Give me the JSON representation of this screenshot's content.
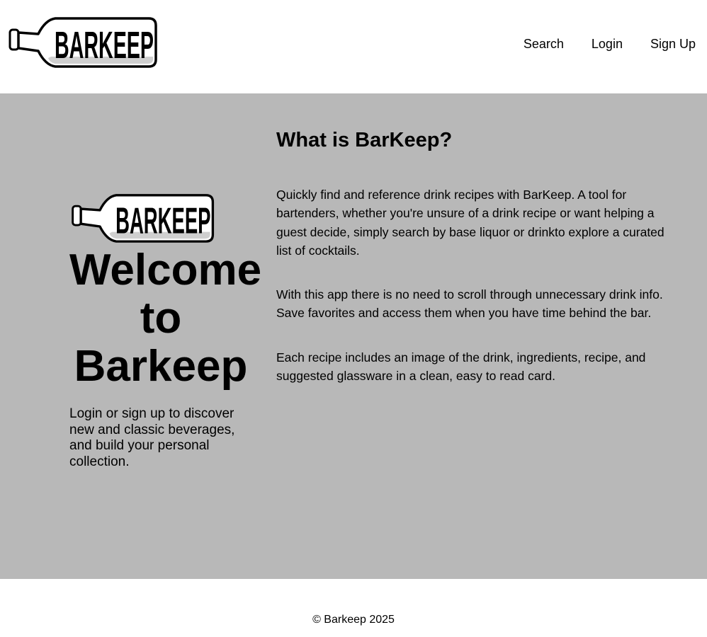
{
  "header": {
    "logo_text": "BARKEEP",
    "nav": {
      "search": "Search",
      "login": "Login",
      "signup": "Sign Up"
    }
  },
  "hero": {
    "logo_text": "BARKEEP",
    "welcome_line1": "Welcome",
    "welcome_line2": "to",
    "welcome_line3": "Barkeep",
    "tagline": "Login or sign up to discover new and classic beverages, and build your personal collection."
  },
  "about": {
    "title": "What is BarKeep?",
    "paragraphs": [
      "Quickly find and reference drink recipes with BarKeep. A tool for bartenders, whether you're unsure of a drink recipe or want helping a guest decide, simply search by base liquor or drinkto explore a curated list of cocktails.",
      "With this app there is no need to scroll through unnecessary drink info. Save favorites and access them when you have time behind the bar.",
      "Each recipe includes an image of the drink, ingredients, recipe, and suggested glassware in a clean, easy to read card."
    ]
  },
  "footer": {
    "copyright": "© Barkeep 2025"
  },
  "colors": {
    "main_background": "#b8b8b8",
    "header_background": "#ffffff",
    "text": "#000000"
  }
}
